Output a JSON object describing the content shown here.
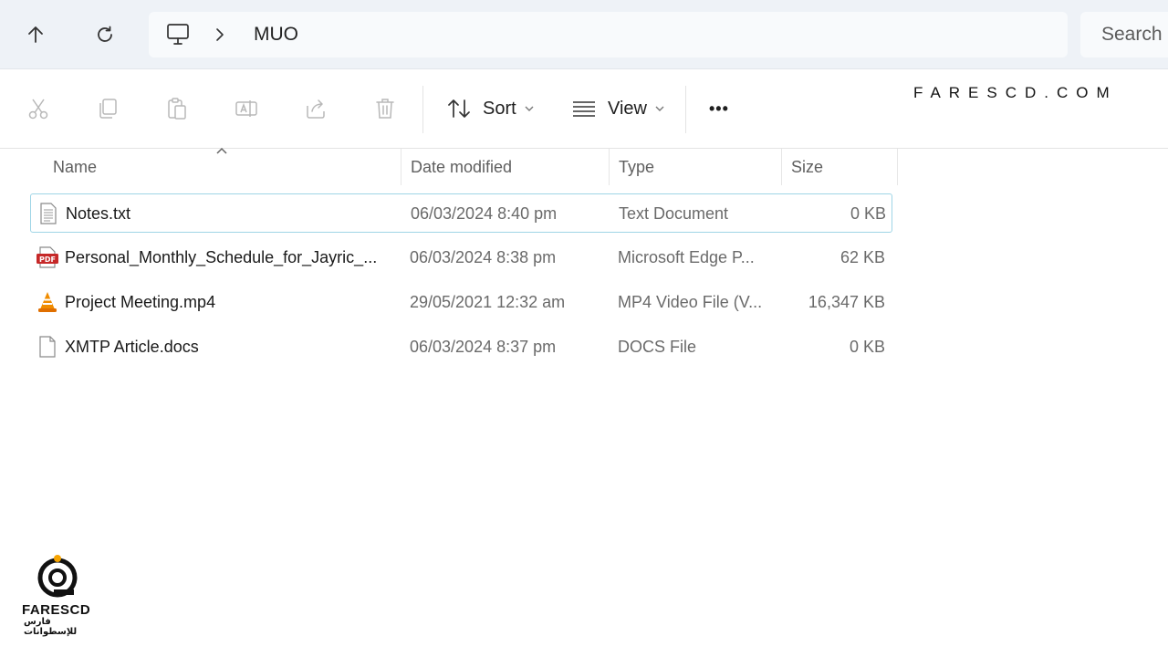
{
  "addressbar": {
    "path_segments": [
      "MUO"
    ],
    "search_placeholder": "Search"
  },
  "toolbar": {
    "sort_label": "Sort",
    "view_label": "View",
    "more_label": "•••"
  },
  "watermark": {
    "text": "FARESCD.COM"
  },
  "columns": {
    "name": "Name",
    "date": "Date modified",
    "type": "Type",
    "size": "Size"
  },
  "files": [
    {
      "name": "Notes.txt",
      "date": "06/03/2024 8:40 pm",
      "type": "Text Document",
      "size": "0 KB",
      "icon": "text-file-icon",
      "selected": true
    },
    {
      "name": "Personal_Monthly_Schedule_for_Jayric_...",
      "date": "06/03/2024 8:38 pm",
      "type": "Microsoft Edge P...",
      "size": "62 KB",
      "icon": "pdf-file-icon",
      "selected": false
    },
    {
      "name": "Project Meeting.mp4",
      "date": "29/05/2021 12:32 am",
      "type": "MP4 Video File (V...",
      "size": "16,347 KB",
      "icon": "vlc-cone-icon",
      "selected": false
    },
    {
      "name": "XMTP Article.docs",
      "date": "06/03/2024 8:37 pm",
      "type": "DOCS File",
      "size": "0 KB",
      "icon": "blank-file-icon",
      "selected": false
    }
  ],
  "logo": {
    "brand": "FARESCD",
    "tagline": "فارس للإسطوانات"
  },
  "colors": {
    "selection_border": "#9fd5e6",
    "addressbar_bg": "#eef2f7",
    "pdf_red": "#c62828",
    "vlc_orange": "#f08c00"
  }
}
